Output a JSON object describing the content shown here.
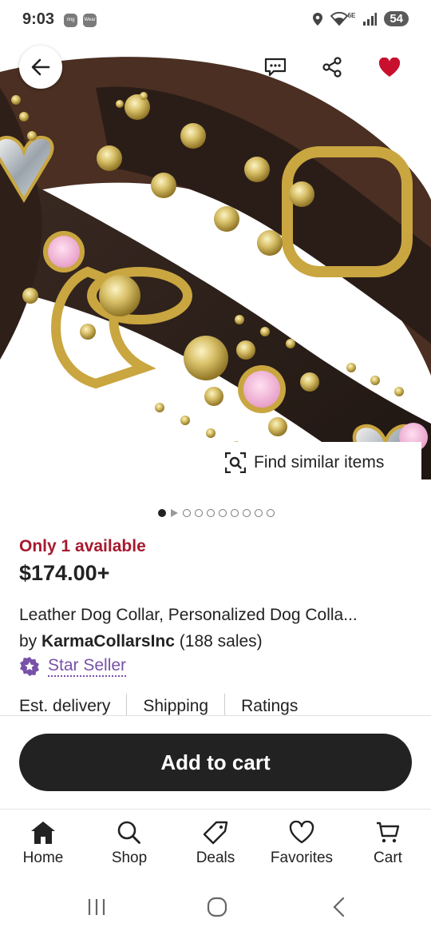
{
  "status_bar": {
    "time": "9:03",
    "apps": [
      "ring",
      "Wear"
    ],
    "network": "6E",
    "battery": "54"
  },
  "hero": {
    "image_description_icon": "dog-collar-photo",
    "find_similar_label": "Find similar items",
    "carousel": {
      "total": 10,
      "active_index": 0
    }
  },
  "product": {
    "availability": "Only 1 available",
    "price": "$174.00+",
    "title": "Leather Dog Collar, Personalized Dog Colla...",
    "by_prefix": "by",
    "seller": "KarmaCollarsInc",
    "sales": "(188 sales)",
    "badge": "Star Seller"
  },
  "tabs": [
    "Est. delivery",
    "Shipping",
    "Ratings"
  ],
  "cart": {
    "button_label": "Add to cart"
  },
  "bottom_nav": [
    {
      "label": "Home",
      "icon": "home-icon",
      "active": true
    },
    {
      "label": "Shop",
      "icon": "search-icon",
      "active": false
    },
    {
      "label": "Deals",
      "icon": "tag-icon",
      "active": false
    },
    {
      "label": "Favorites",
      "icon": "heart-icon",
      "active": false
    },
    {
      "label": "Cart",
      "icon": "cart-icon",
      "active": false
    }
  ],
  "colors": {
    "accent_red": "#a61a2e",
    "star_seller_purple": "#7851a9",
    "favorite_heart": "#c8102e",
    "button_dark": "#222222"
  }
}
